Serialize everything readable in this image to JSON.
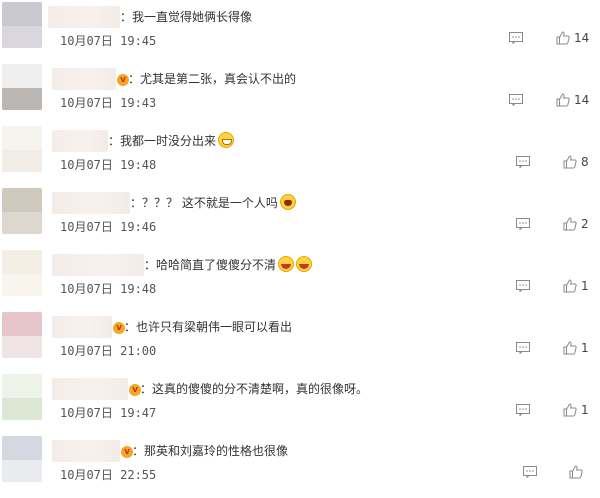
{
  "comments": [
    {
      "text": "：我一直觉得她俩长得像",
      "time": "10月07日 19:45",
      "likes": "14"
    },
    {
      "text": "：尤其是第二张，真会认不出的",
      "time": "10月07日 19:43",
      "likes": "14"
    },
    {
      "text": "：我都一时没分出来",
      "time": "10月07日 19:48",
      "likes": "8"
    },
    {
      "text": "：？？？ 这不就是一个人吗",
      "time": "10月07日 19:46",
      "likes": "2"
    },
    {
      "text": "：哈哈简直了傻傻分不清",
      "time": "10月07日 19:48",
      "likes": "1"
    },
    {
      "text": "：也许只有梁朝伟一眼可以看出",
      "time": "10月07日 21:00",
      "likes": "1"
    },
    {
      "text": "：这真的傻傻的分不清楚啊，真的很像呀。",
      "time": "10月07日 19:47",
      "likes": "1"
    },
    {
      "text": "：那英和刘嘉玲的性格也很像",
      "time": "10月07日 22:55",
      "likes": ""
    }
  ],
  "icons": {
    "reply": "comment-icon",
    "like": "thumbs-up-icon",
    "emoji_smile": "grin-emoji-icon",
    "emoji_cry": "cry-laugh-emoji-icon",
    "emoji_laugh": "laugh-emoji-icon",
    "vip": "vip-badge-icon"
  },
  "colors": {
    "text": "#333333",
    "meta": "#555555",
    "icon": "#8a8a8a"
  }
}
